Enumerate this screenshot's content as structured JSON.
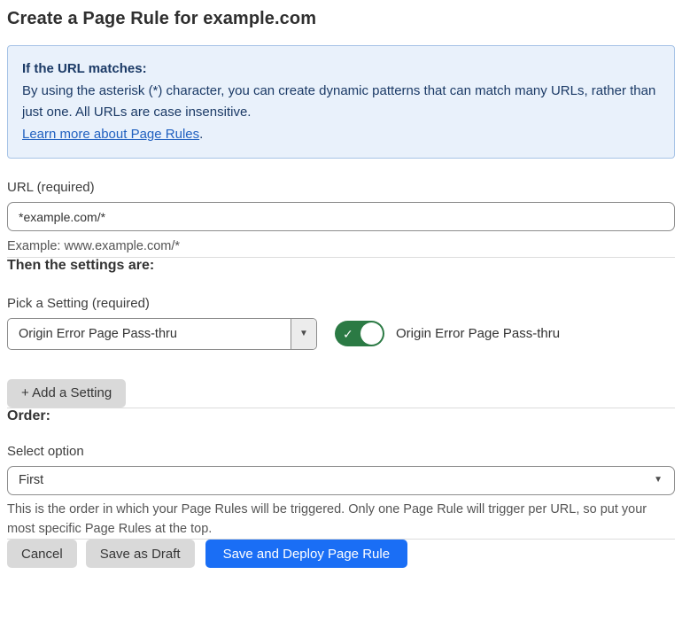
{
  "page": {
    "title": "Create a Page Rule for example.com"
  },
  "info_box": {
    "heading": "If the URL matches:",
    "body": "By using the asterisk (*) character, you can create dynamic patterns that can match many URLs, rather than just one. All URLs are case insensitive.",
    "link": "Learn more about Page Rules",
    "link_suffix": "."
  },
  "url_field": {
    "label": "URL (required)",
    "value": "*example.com/*",
    "helper": "Example: www.example.com/*"
  },
  "settings": {
    "heading": "Then the settings are:",
    "picker_label": "Pick a Setting (required)",
    "picker_value": "Origin Error Page Pass-thru",
    "toggle_label": "Origin Error Page Pass-thru",
    "toggle_state": "on",
    "add_button_label": "+ Add a Setting"
  },
  "order": {
    "heading": "Order:",
    "select_label": "Select option",
    "select_value": "First",
    "helper": "This is the order in which your Page Rules will be triggered. Only one Page Rule will trigger per URL, so put your most specific Page Rules at the top."
  },
  "footer": {
    "cancel_label": "Cancel",
    "save_draft_label": "Save as Draft",
    "save_deploy_label": "Save and Deploy Page Rule"
  },
  "icons": {
    "toggle_check": "check-icon",
    "dropdown_caret": "caret-down-icon"
  },
  "colors": {
    "accent_blue": "#1a6ef5",
    "toggle_green": "#2b7a44",
    "info_background": "#e9f1fb",
    "info_border": "#a6c3e6",
    "info_text": "#1b3a66",
    "link_blue": "#2161c0",
    "button_gray": "#d9d9d9"
  }
}
